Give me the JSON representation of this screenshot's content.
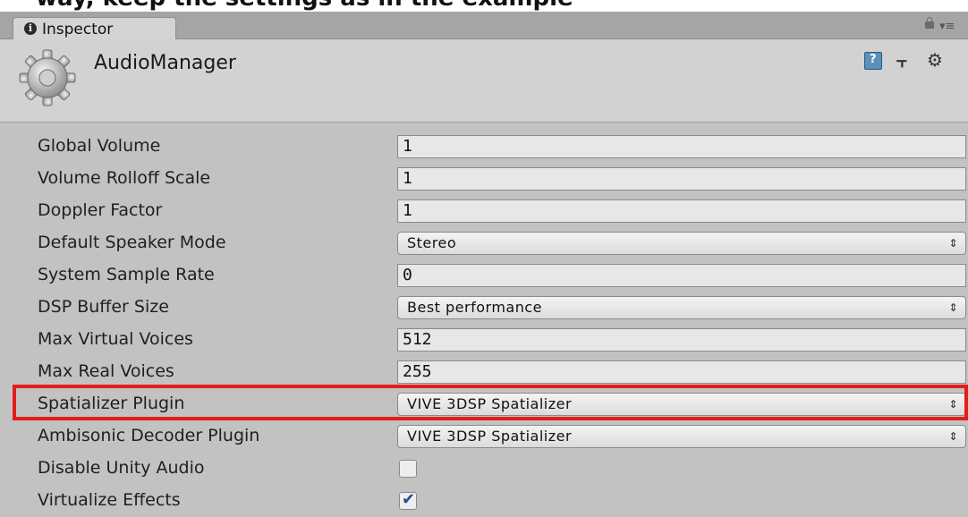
{
  "caption": {
    "text": "way, keep the settings as in the example"
  },
  "tab": {
    "label": "Inspector",
    "info_icon": "info-icon"
  },
  "header": {
    "title": "AudioManager"
  },
  "properties": [
    {
      "label": "Global Volume",
      "type": "number",
      "value": "1"
    },
    {
      "label": "Volume Rolloff Scale",
      "type": "number",
      "value": "1"
    },
    {
      "label": "Doppler Factor",
      "type": "number",
      "value": "1"
    },
    {
      "label": "Default Speaker Mode",
      "type": "dropdown",
      "value": "Stereo"
    },
    {
      "label": "System Sample Rate",
      "type": "number",
      "value": "0"
    },
    {
      "label": "DSP Buffer Size",
      "type": "dropdown",
      "value": "Best performance"
    },
    {
      "label": "Max Virtual Voices",
      "type": "number",
      "value": "512"
    },
    {
      "label": "Max Real Voices",
      "type": "number",
      "value": "255"
    },
    {
      "label": "Spatializer Plugin",
      "type": "dropdown",
      "value": "VIVE 3DSP Spatializer",
      "highlighted": true
    },
    {
      "label": "Ambisonic Decoder Plugin",
      "type": "dropdown",
      "value": "VIVE 3DSP Spatializer"
    },
    {
      "label": "Disable Unity Audio",
      "type": "checkbox",
      "checked": false
    },
    {
      "label": "Virtualize Effects",
      "type": "checkbox",
      "checked": true
    }
  ],
  "colors": {
    "highlight": "#e51c1c",
    "checkmark": "#1f4e9b"
  }
}
